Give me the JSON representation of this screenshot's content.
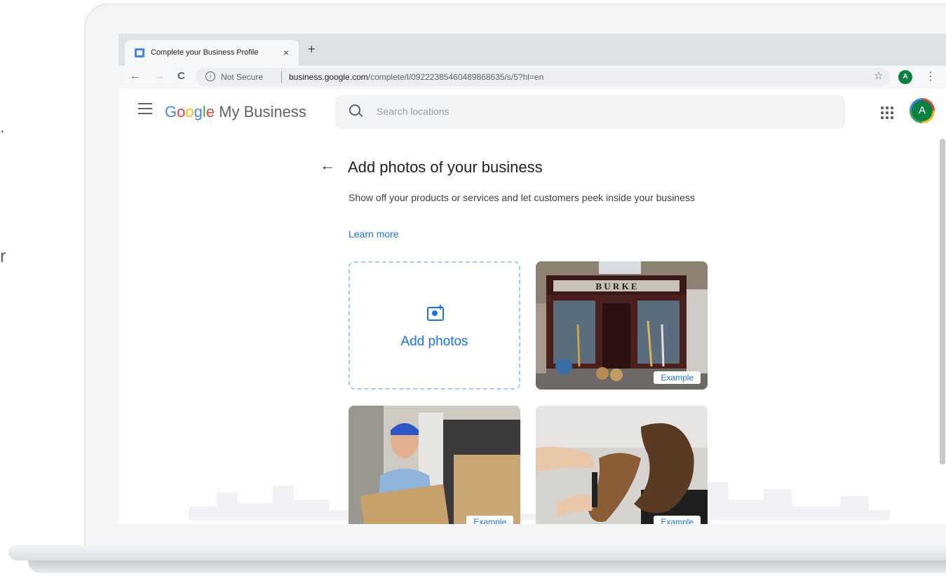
{
  "background": {
    "left_fragments": [
      ".",
      "r"
    ]
  },
  "browser": {
    "tab_title": "Complete your Business Profile",
    "tab_close": "×",
    "new_tab": "+",
    "toolbar": {
      "back": "←",
      "forward": "→",
      "reload": "C",
      "info": "i",
      "security_label": "Not Secure",
      "url_host": "business.google.com",
      "url_path": "/complete/l/09222385460489868635/s/5?hl=en",
      "star": "☆",
      "profile_initial": "A",
      "menu": "⋮"
    }
  },
  "appbar": {
    "logo": {
      "G1": "G",
      "o1": "o",
      "o2": "o",
      "g2": "g",
      "l": "l",
      "e": "e"
    },
    "product": " My Business",
    "search_placeholder": "Search locations",
    "avatar_initial": "A"
  },
  "page": {
    "back_arrow": "←",
    "title": "Add photos of your business",
    "description": "Show off your products or services and let customers peek inside your business",
    "learn_more": "Learn more",
    "add_plus": "+",
    "add_photos_label": "Add photos",
    "shop_sign": "B U R K E",
    "example_label": "Example"
  },
  "colors": {
    "accent": "#1a73e8",
    "google_blue": "#4285f4",
    "google_red": "#ea4335",
    "google_yellow": "#fbbc05",
    "google_green": "#34a853",
    "avatar_green": "#0b8043"
  }
}
